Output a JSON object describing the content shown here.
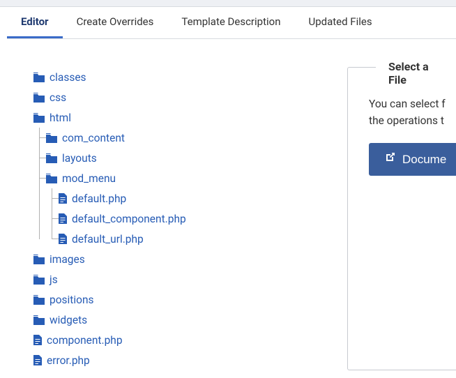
{
  "tabs": {
    "editor": "Editor",
    "create_overrides": "Create Overrides",
    "template_description": "Template Description",
    "updated_files": "Updated Files"
  },
  "tree": {
    "classes": "classes",
    "css": "css",
    "html": "html",
    "com_content": "com_content",
    "layouts": "layouts",
    "mod_menu": "mod_menu",
    "default_php": "default.php",
    "default_component_php": "default_component.php",
    "default_url_php": "default_url.php",
    "images": "images",
    "js": "js",
    "positions": "positions",
    "widgets": "widgets",
    "component_php": "component.php",
    "error_php": "error.php"
  },
  "panel": {
    "title": "Select a File",
    "text_line1": "You can select f",
    "text_line2": "the operations t",
    "button_label": "Docume"
  },
  "colors": {
    "link": "#275cb5",
    "tab_active_border": "#3a6bc8",
    "button_bg": "#3a5e9c"
  }
}
